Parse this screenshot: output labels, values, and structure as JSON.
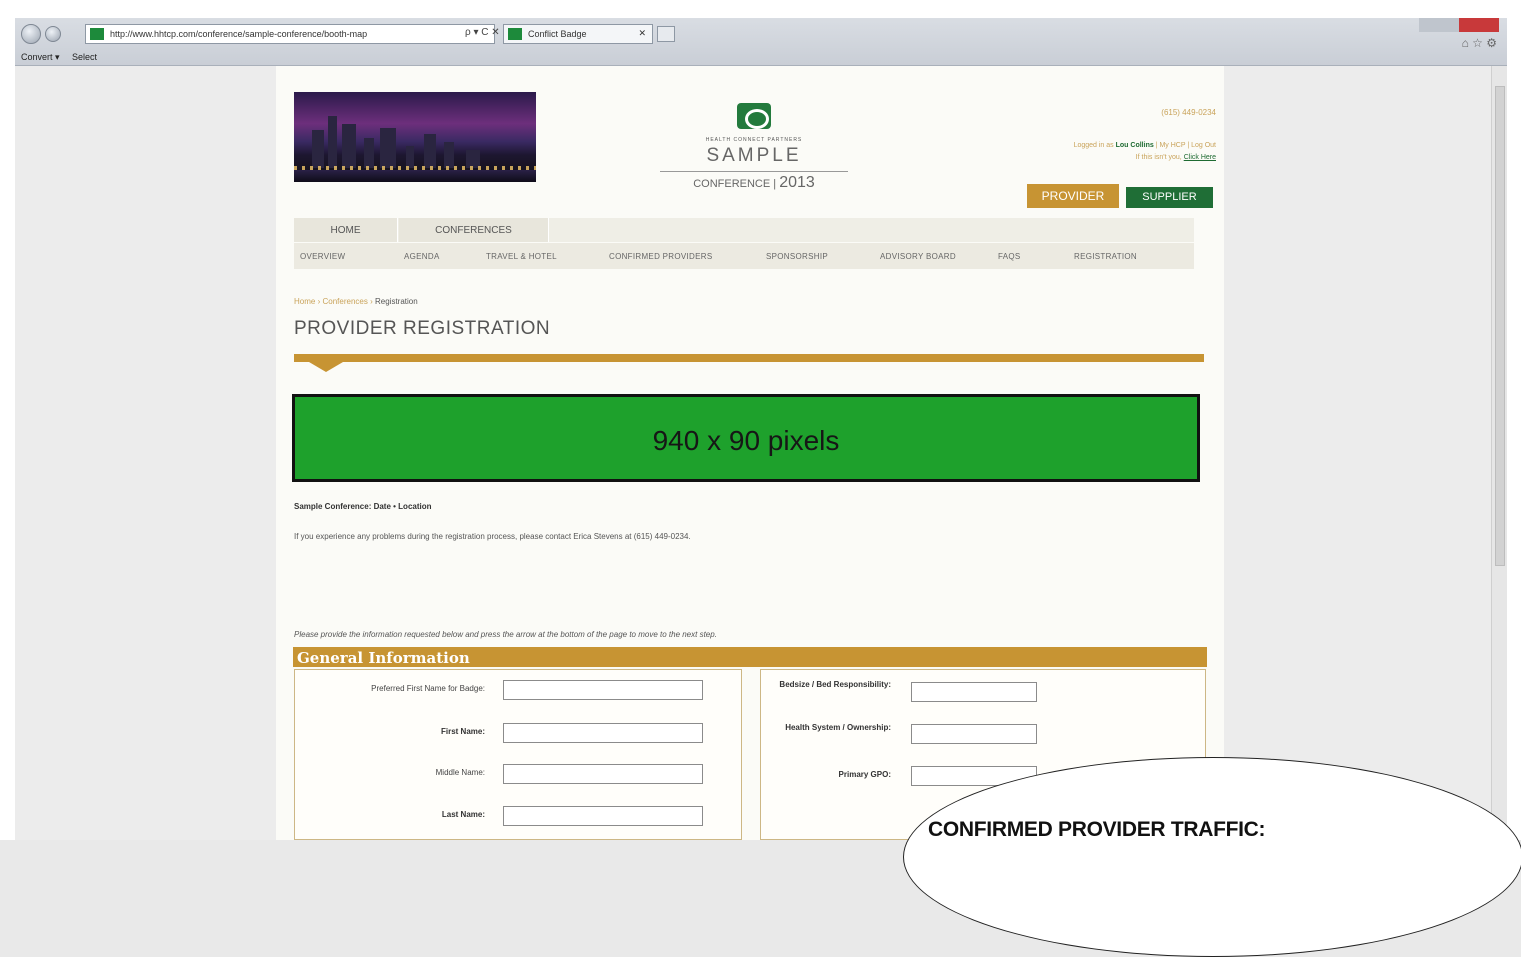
{
  "browser": {
    "address_url": "http://www.hhtcp.com/conference/sample-conference/booth-map",
    "address_tools": "ρ ▾ C ✕",
    "tab_title": "Conflict Badge",
    "tab_close": "✕",
    "command_bar": {
      "convert": "Convert ▾",
      "select": "Select"
    },
    "toolbar_icons": "⌂ ☆ ⚙"
  },
  "header": {
    "logo_small": "HEALTH CONNECT PARTNERS",
    "logo_name": "SAMPLE",
    "logo_conference": "CONFERENCE",
    "logo_year": "2013",
    "phone": "(615) 449-0234",
    "logged_prefix": "Logged in as",
    "logged_user": "Lou Collins",
    "logged_links": "| My HCP | Log Out",
    "not_you": "If this isn't you,",
    "click_here": "Click Here",
    "provider_button": "PROVIDER",
    "supplier_button": "SUPPLIER"
  },
  "nav": {
    "top": [
      "HOME",
      "CONFERENCES"
    ],
    "sub": [
      "OVERVIEW",
      "AGENDA",
      "TRAVEL & HOTEL",
      "CONFIRMED PROVIDERS",
      "SPONSORSHIP",
      "ADVISORY BOARD",
      "FAQS",
      "REGISTRATION"
    ]
  },
  "breadcrumb": {
    "home": "Home",
    "sep": "›",
    "conferences": "Conferences",
    "current": "Registration"
  },
  "page_title": "PROVIDER REGISTRATION",
  "banner_text": "940 x 90 pixels",
  "conference_line": "Sample Conference:  Date  •  Location",
  "problem_text": "If you experience any problems during the registration process, please contact Erica Stevens at (615) 449-0234.",
  "instructions": "Please provide the information requested below and press the arrow at the bottom of the page to move to the next step.",
  "section_title": "General Information",
  "left_fields": [
    "Preferred First Name for Badge:",
    "First Name:",
    "Middle Name:",
    "Last Name:"
  ],
  "right_fields": [
    "Bedsize / Bed Responsibility:",
    "Health System / Ownership:",
    "Primary GPO:"
  ],
  "callout_text": "CONFIRMED PROVIDER TRAFFIC:"
}
